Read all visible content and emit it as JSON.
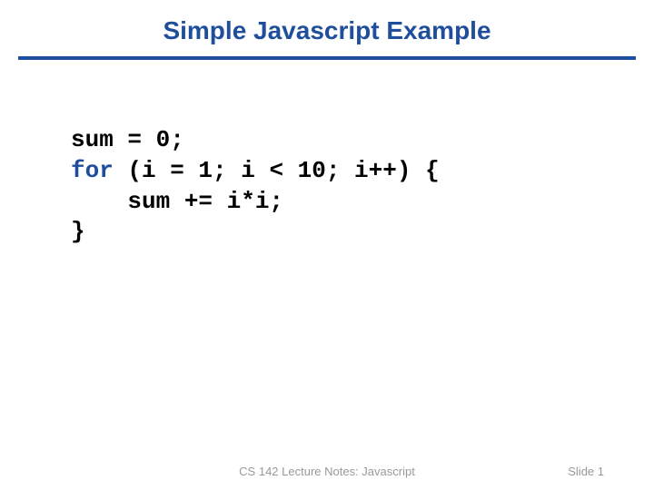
{
  "title": "Simple Javascript Example",
  "code": {
    "line1": "sum = 0;",
    "line2_keyword": "for",
    "line2_rest": " (i = 1; i < 10; i++) {",
    "line3": "    sum += i*i;",
    "line4": "}"
  },
  "footer": {
    "center": "CS 142 Lecture Notes: Javascript",
    "right": "Slide 1"
  }
}
